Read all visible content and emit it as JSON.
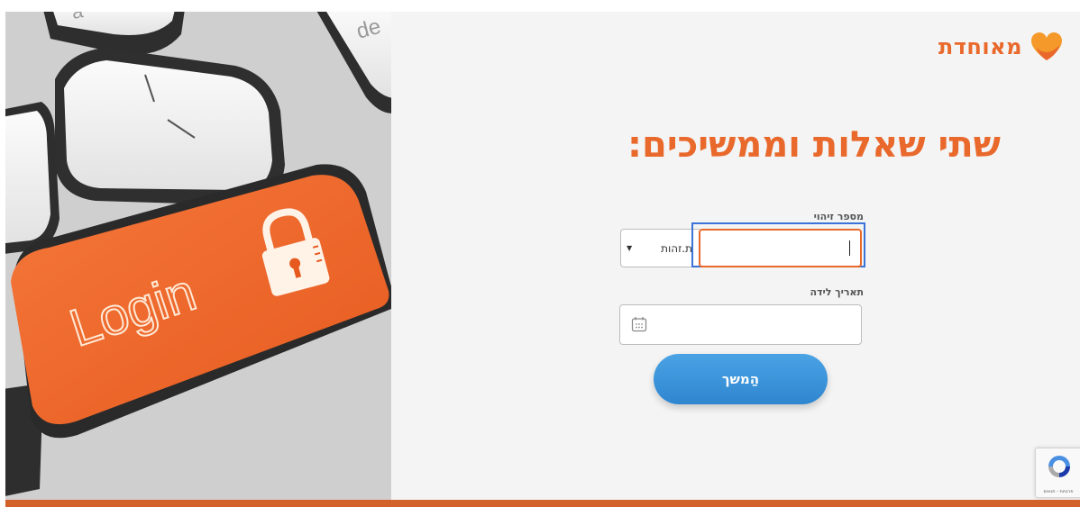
{
  "brand": {
    "name": "מאוחדת",
    "color": "#e9692c",
    "mark_icon": "heart-logo-icon"
  },
  "hero": {
    "key_label": "Login",
    "lock_icon": "padlock-icon"
  },
  "form": {
    "headline": "שתי שאלות וממשיכים:",
    "id_label": "מספר זיהוי",
    "id_value": "",
    "id_type_selected": "ת.זהות",
    "dob_label": "תאריך לידה",
    "dob_value": "",
    "dob_icon": "calendar-icon",
    "continue_label": "הַמשך",
    "button_color": "#3a93db"
  },
  "recaptcha": {
    "links": "פרטיות - תנאים"
  },
  "footer_bar_color": "#d2612a"
}
